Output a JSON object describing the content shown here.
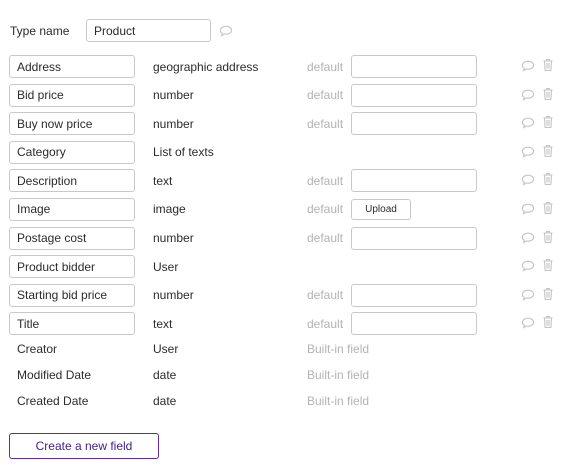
{
  "type": {
    "label": "Type name",
    "value": "Product"
  },
  "fields": [
    {
      "name": "Address",
      "type": "geographic address",
      "default_label": "default",
      "default_kind": "input"
    },
    {
      "name": "Bid price",
      "type": "number",
      "default_label": "default",
      "default_kind": "input"
    },
    {
      "name": "Buy now price",
      "type": "number",
      "default_label": "default",
      "default_kind": "input"
    },
    {
      "name": "Category",
      "type": "List of texts",
      "default_label": "",
      "default_kind": "none"
    },
    {
      "name": "Description",
      "type": "text",
      "default_label": "default",
      "default_kind": "input"
    },
    {
      "name": "Image",
      "type": "image",
      "default_label": "default",
      "default_kind": "upload",
      "upload_label": "Upload"
    },
    {
      "name": "Postage cost",
      "type": "number",
      "default_label": "default",
      "default_kind": "input"
    },
    {
      "name": "Product bidder",
      "type": "User",
      "default_label": "",
      "default_kind": "none"
    },
    {
      "name": "Starting bid price",
      "type": "number",
      "default_label": "default",
      "default_kind": "input"
    },
    {
      "name": "Title",
      "type": "text",
      "default_label": "default",
      "default_kind": "input"
    }
  ],
  "builtin_fields": [
    {
      "name": "Creator",
      "type": "User",
      "tag": "Built-in field"
    },
    {
      "name": "Modified Date",
      "type": "date",
      "tag": "Built-in field"
    },
    {
      "name": "Created Date",
      "type": "date",
      "tag": "Built-in field"
    }
  ],
  "actions": {
    "create_label": "Create a new field"
  },
  "icons": {
    "comment": "comment-icon",
    "trash": "trash-icon"
  },
  "colors": {
    "accent": "#5b2aa8",
    "muted": "#b3b3b3",
    "border": "#c9c9c9",
    "icon": "#c4c4c4"
  }
}
